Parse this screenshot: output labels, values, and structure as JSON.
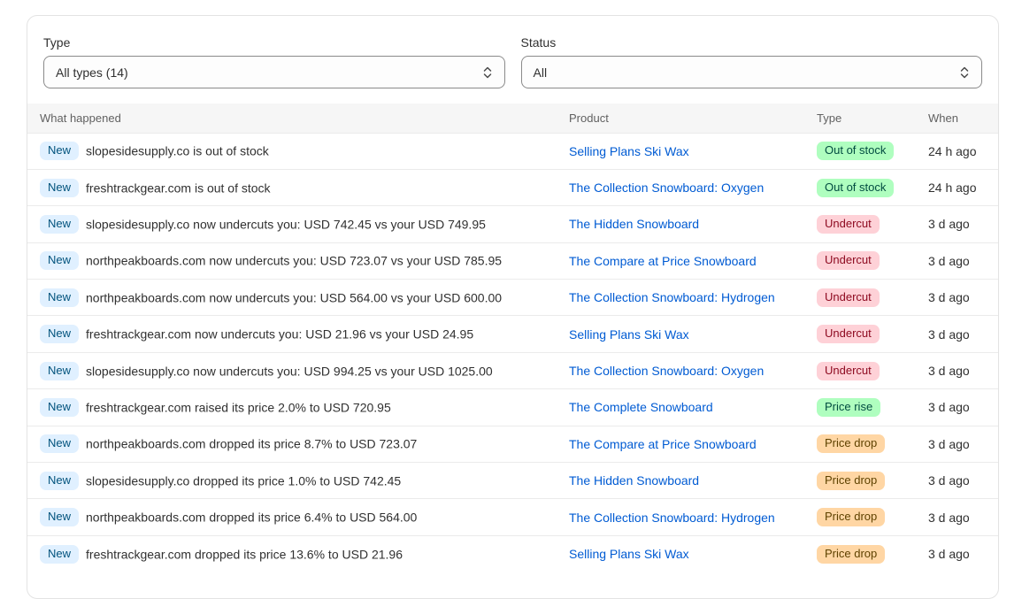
{
  "filters": {
    "type": {
      "label": "Type",
      "value": "All types (14)"
    },
    "status": {
      "label": "Status",
      "value": "All"
    }
  },
  "table": {
    "headers": {
      "what": "What happened",
      "product": "Product",
      "type": "Type",
      "when": "When"
    },
    "rows": [
      {
        "badge": "New",
        "what": "slopesidesupply.co is out of stock",
        "product": "Selling Plans Ski Wax",
        "type": "Out of stock",
        "type_kind": "stock",
        "when": "24 h ago"
      },
      {
        "badge": "New",
        "what": "freshtrackgear.com is out of stock",
        "product": "The Collection Snowboard: Oxygen",
        "type": "Out of stock",
        "type_kind": "stock",
        "when": "24 h ago"
      },
      {
        "badge": "New",
        "what": "slopesidesupply.co now undercuts you: USD 742.45 vs your USD 749.95",
        "product": "The Hidden Snowboard",
        "type": "Undercut",
        "type_kind": "undercut",
        "when": "3 d ago"
      },
      {
        "badge": "New",
        "what": "northpeakboards.com now undercuts you: USD 723.07 vs your USD 785.95",
        "product": "The Compare at Price Snowboard",
        "type": "Undercut",
        "type_kind": "undercut",
        "when": "3 d ago"
      },
      {
        "badge": "New",
        "what": "northpeakboards.com now undercuts you: USD 564.00 vs your USD 600.00",
        "product": "The Collection Snowboard: Hydrogen",
        "type": "Undercut",
        "type_kind": "undercut",
        "when": "3 d ago"
      },
      {
        "badge": "New",
        "what": "freshtrackgear.com now undercuts you: USD 21.96 vs your USD 24.95",
        "product": "Selling Plans Ski Wax",
        "type": "Undercut",
        "type_kind": "undercut",
        "when": "3 d ago"
      },
      {
        "badge": "New",
        "what": "slopesidesupply.co now undercuts you: USD 994.25 vs your USD 1025.00",
        "product": "The Collection Snowboard: Oxygen",
        "type": "Undercut",
        "type_kind": "undercut",
        "when": "3 d ago"
      },
      {
        "badge": "New",
        "what": "freshtrackgear.com raised its price 2.0% to USD 720.95",
        "product": "The Complete Snowboard",
        "type": "Price rise",
        "type_kind": "rise",
        "when": "3 d ago"
      },
      {
        "badge": "New",
        "what": "northpeakboards.com dropped its price 8.7% to USD 723.07",
        "product": "The Compare at Price Snowboard",
        "type": "Price drop",
        "type_kind": "drop",
        "when": "3 d ago"
      },
      {
        "badge": "New",
        "what": "slopesidesupply.co dropped its price 1.0% to USD 742.45",
        "product": "The Hidden Snowboard",
        "type": "Price drop",
        "type_kind": "drop",
        "when": "3 d ago"
      },
      {
        "badge": "New",
        "what": "northpeakboards.com dropped its price 6.4% to USD 564.00",
        "product": "The Collection Snowboard: Hydrogen",
        "type": "Price drop",
        "type_kind": "drop",
        "when": "3 d ago"
      },
      {
        "badge": "New",
        "what": "freshtrackgear.com dropped its price 13.6% to USD 21.96",
        "product": "Selling Plans Ski Wax",
        "type": "Price drop",
        "type_kind": "drop",
        "when": "3 d ago"
      }
    ]
  }
}
